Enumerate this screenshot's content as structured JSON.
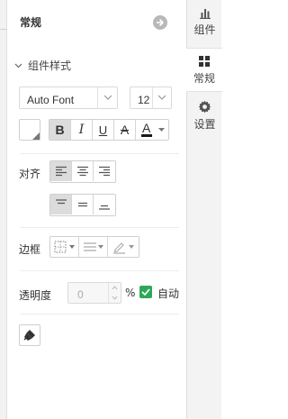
{
  "panel": {
    "title": "常规",
    "section_label": "组件样式"
  },
  "side_tabs": [
    {
      "label": "组件",
      "icon": "bar-chart-icon"
    },
    {
      "label": "常规",
      "icon": "grid-icon"
    },
    {
      "label": "设置",
      "icon": "gear-icon"
    }
  ],
  "font": {
    "family_value": "Auto Font",
    "size_value": "12"
  },
  "format_buttons": {
    "bold": "B",
    "italic": "I",
    "underline": "U",
    "strike": "A",
    "font_color": "A"
  },
  "colors": {
    "font_color_bar": "#1a1a1a",
    "checkbox_green": "#2fa75a",
    "active_toggle": "#dcdcdc"
  },
  "align": {
    "label": "对齐",
    "horizontal_selected": "left",
    "vertical_selected": "top"
  },
  "border": {
    "label": "边框"
  },
  "opacity": {
    "label": "透明度",
    "value": "0",
    "unit": "%",
    "auto_label": "自动",
    "auto_checked": true
  }
}
